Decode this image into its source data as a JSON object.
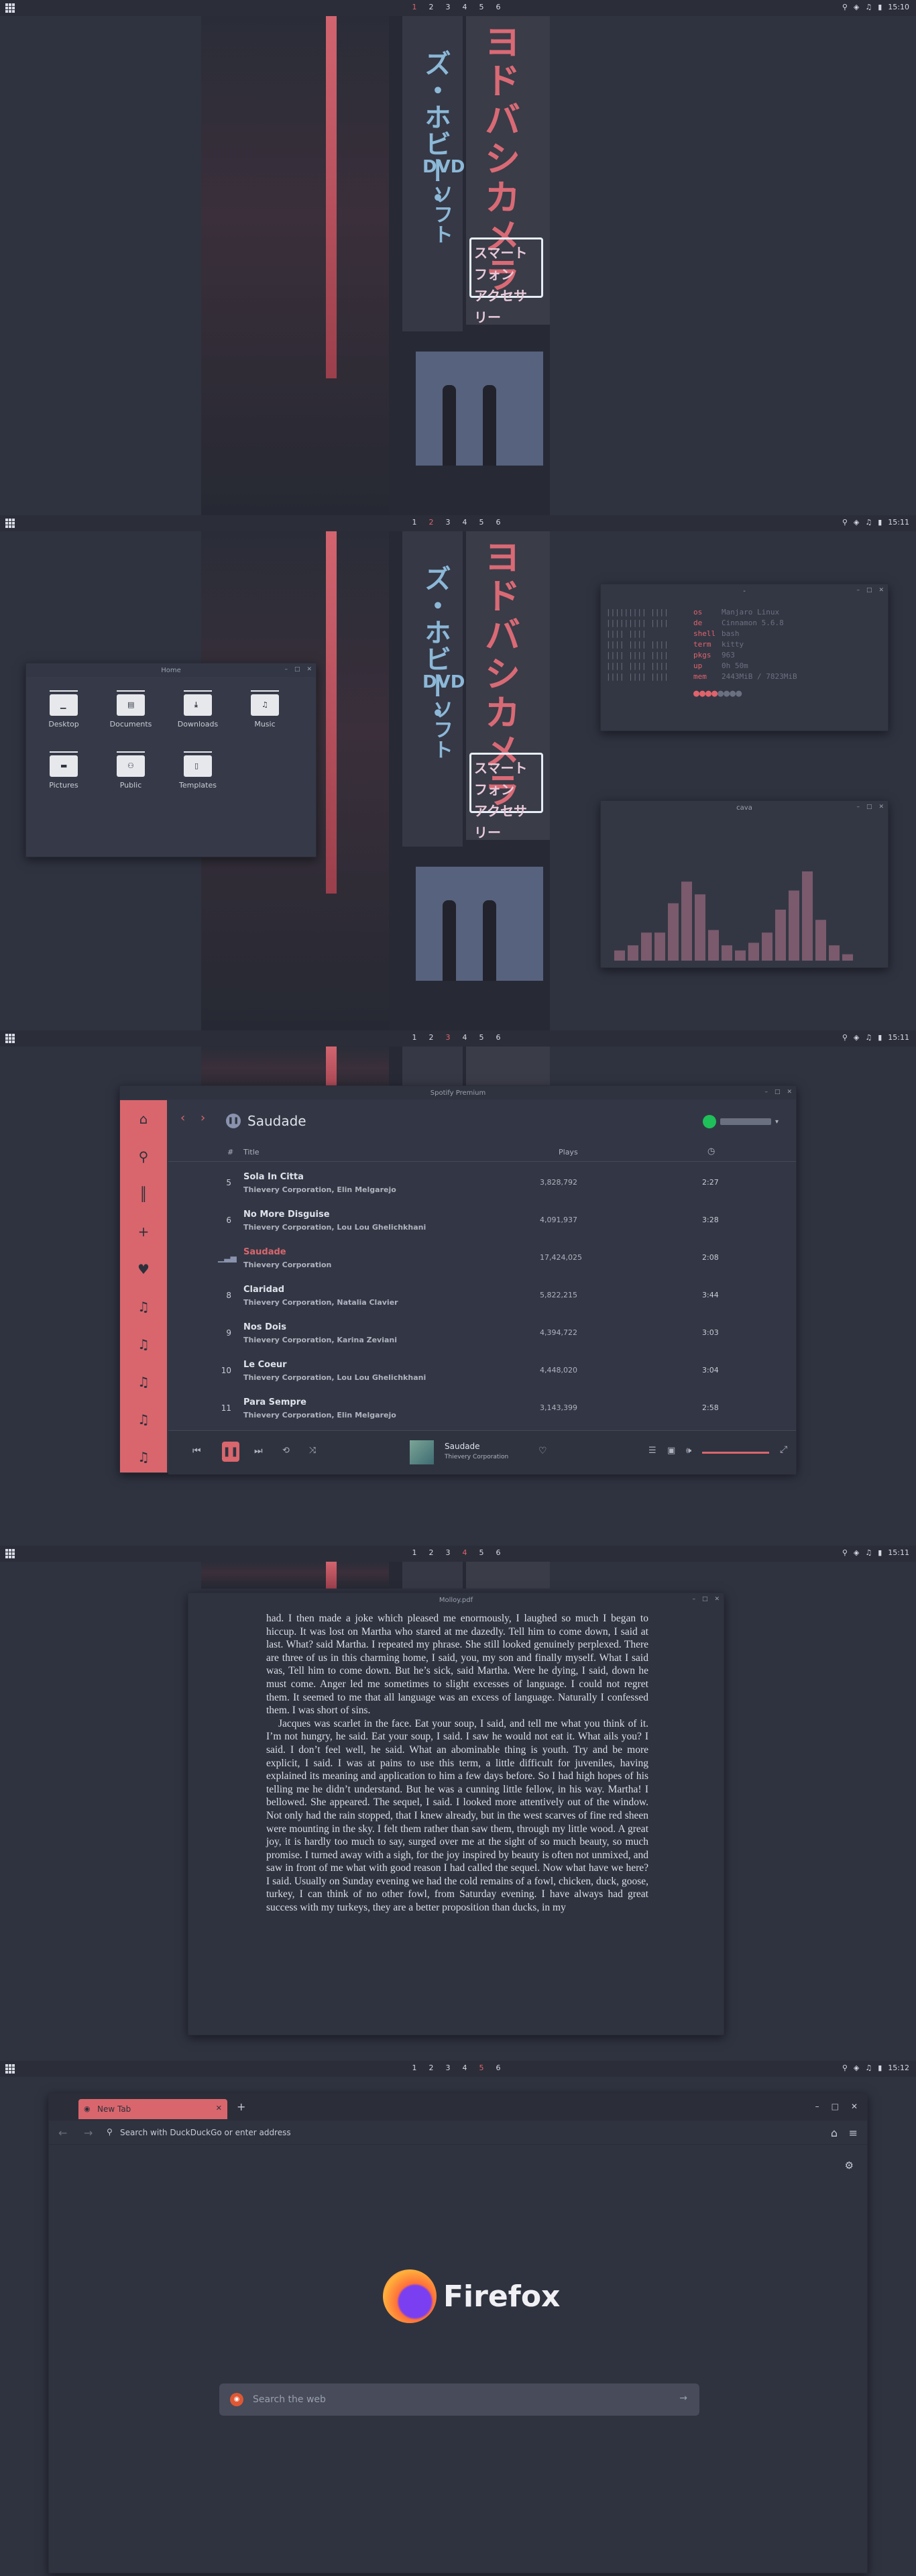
{
  "topbar": {
    "tags": [
      "1",
      "2",
      "3",
      "4",
      "5",
      "6"
    ],
    "times": [
      "15:10",
      "15:11",
      "15:11",
      "15:11",
      "15:12"
    ],
    "active_tag": [
      "1",
      "2",
      "3",
      "4",
      "5"
    ]
  },
  "wallpaper": {
    "sign_red": "ヨドバシカメラ",
    "sign_blue": "ズ・ホビー・",
    "sign_dvd": "DVD",
    "sign_dvd_kana": "ソフト",
    "sign_box_line1": "スマートフォン",
    "sign_box_line2": "アクセサリー"
  },
  "files": {
    "title": "Home",
    "folders": [
      "Desktop",
      "Documents",
      "Downloads",
      "Music",
      "Pictures",
      "Public",
      "Templates"
    ]
  },
  "fetch": {
    "title": "-",
    "keys": [
      "os",
      "de",
      "shell",
      "term",
      "pkgs",
      "up",
      "mem"
    ],
    "values": [
      "Manjaro Linux",
      "Cinnamon 5.6.8",
      "bash",
      "kitty",
      "963",
      "0h 50m",
      "2443MiB / 7823MiB"
    ]
  },
  "cava": {
    "title": "cava",
    "levels": [
      0.08,
      0.12,
      0.22,
      0.22,
      0.45,
      0.62,
      0.52,
      0.24,
      0.12,
      0.08,
      0.14,
      0.22,
      0.4,
      0.55,
      0.7,
      0.32,
      0.12,
      0.05
    ]
  },
  "spotify": {
    "title": "Spotify Premium",
    "playlist": "Saudade",
    "col_num": "#",
    "col_title": "Title",
    "col_plays": "Plays",
    "tracks": [
      {
        "num": "5",
        "title": "Sola In Citta",
        "artist": "Thievery Corporation, Elin Melgarejo",
        "plays": "3,828,792",
        "dur": "2:27"
      },
      {
        "num": "6",
        "title": "No More Disguise",
        "artist": "Thievery Corporation, Lou Lou Ghelichkhani",
        "plays": "4,091,937",
        "dur": "3:28"
      },
      {
        "num": "",
        "title": "Saudade",
        "artist": "Thievery Corporation",
        "plays": "17,424,025",
        "dur": "2:08"
      },
      {
        "num": "8",
        "title": "Claridad",
        "artist": "Thievery Corporation, Natalia Clavier",
        "plays": "5,822,215",
        "dur": "3:44"
      },
      {
        "num": "9",
        "title": "Nos Dois",
        "artist": "Thievery Corporation, Karina Zeviani",
        "plays": "4,394,722",
        "dur": "3:03"
      },
      {
        "num": "10",
        "title": "Le Coeur",
        "artist": "Thievery Corporation, Lou Lou Ghelichkhani",
        "plays": "4,448,020",
        "dur": "3:04"
      },
      {
        "num": "11",
        "title": "Para Sempre",
        "artist": "Thievery Corporation, Elin Melgarejo",
        "plays": "3,143,399",
        "dur": "2:58"
      }
    ],
    "now_title": "Saudade",
    "now_artist": "Thievery Corporation"
  },
  "pdf": {
    "title": "Molloy.pdf",
    "p1": "had. I then made a joke which pleased me enormously, I laughed so much I began to hiccup. It was lost on Martha who stared at me dazedly. Tell him to come down, I said at last. What? said Martha. I repeated my phrase. She still looked genuinely perplexed. There are three of us in this charming home, I said, you, my son and finally myself. What I said was, Tell him to come down. But he’s sick, said Martha. Were he dying, I said, down he must come. Anger led me sometimes to slight excesses of language. I could not regret them. It seemed to me that all language was an excess of language. Naturally I confessed them. I was short of sins.",
    "p2": "Jacques was scarlet in the face. Eat your soup, I said, and tell me what you think of it. I’m not hungry, he said. Eat your soup, I said. I saw he would not eat it. What ails you? I said. I don’t feel well, he said. What an abominable thing is youth. Try and be more explicit, I said. I was at pains to use this term, a little difficult for juveniles, having explained its meaning and application to him a few days before. So I had high hopes of his telling me he didn’t understand. But he was a cunning little fellow, in his way. Martha! I bellowed. She appeared. The sequel, I said. I looked more attentively out of the window. Not only had the rain stopped, that I knew already, but in the west scarves of fine red sheen were mounting in the sky. I felt them rather than saw them, through my little wood. A great joy, it is hardly too much to say, surged over me at the sight of so much beauty, so much promise. I turned away with a sigh, for the joy inspired by beauty is often not unmixed, and saw in front of me what with good reason I had called the sequel. Now what have we here? I said. Usually on Sunday evening we had the cold remains of a fowl, chicken, duck, goose, turkey, I can think of no other fowl, from Saturday evening. I have always had great success with my turkeys, they are a better proposition than ducks, in my"
  },
  "firefox": {
    "tab_label": "New Tab",
    "address_placeholder": "Search with DuckDuckGo or enter address",
    "brand": "Firefox",
    "search_placeholder": "Search the web"
  },
  "colors": {
    "accent": "#d9666d",
    "bg": "#2f3340",
    "panel": "#363a48"
  }
}
